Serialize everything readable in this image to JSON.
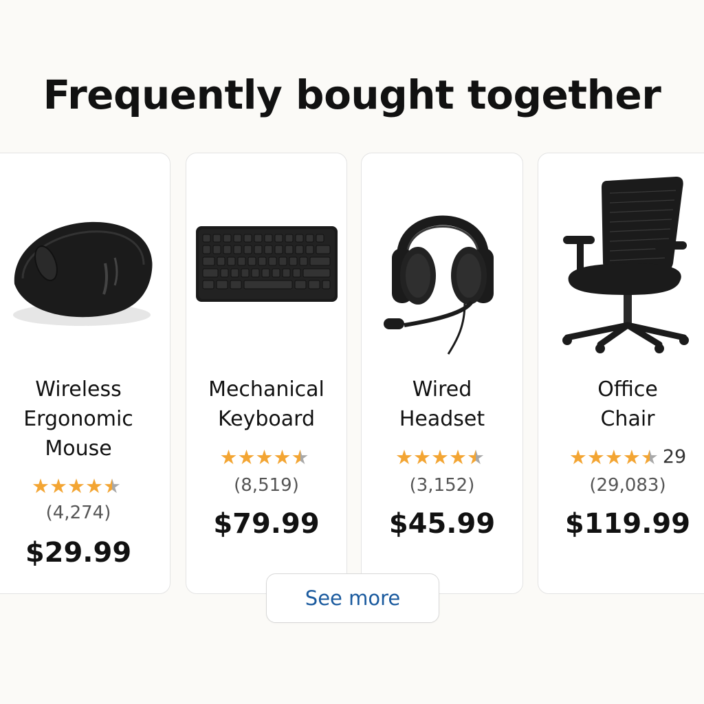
{
  "header": {
    "title": "Frequently bought together"
  },
  "products": [
    {
      "icon": "mouse-icon",
      "name": "Wireless\nErgonomic\nMouse",
      "rating_value": 4.5,
      "rating_extra": "",
      "review_count": "(4,274)",
      "price": "$29.99"
    },
    {
      "icon": "keyboard-icon",
      "name": "Mechanical\nKeyboard",
      "rating_value": 4.5,
      "rating_extra": "",
      "review_count": "(8,519)",
      "price": "$79.99"
    },
    {
      "icon": "headset-icon",
      "name": "Wired\nHeadset",
      "rating_value": 4.5,
      "rating_extra": "",
      "review_count": "(3,152)",
      "price": "$45.99"
    },
    {
      "icon": "office-chair-icon",
      "name": "Office\nChair",
      "rating_value": 4.5,
      "rating_extra": "29",
      "review_count": "(29,083)",
      "price": "$119.99"
    }
  ],
  "footer": {
    "see_more_label": "See more"
  },
  "colors": {
    "star": "#f3a533",
    "link": "#1a5a9e",
    "background": "#fbfaf7"
  }
}
